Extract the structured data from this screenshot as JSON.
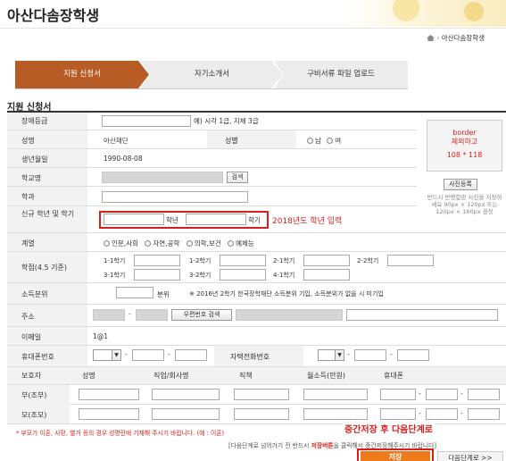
{
  "page": {
    "title": "아산다솜장학생",
    "breadcrumb": "아산다솜장학생"
  },
  "tabs": [
    {
      "label": "지원 신청서",
      "active": true
    },
    {
      "label": "자기소개서",
      "active": false
    },
    {
      "label": "구비서류 파일 업로드",
      "active": false
    }
  ],
  "section_title": "지원 신청서",
  "form": {
    "grade_label": "장애등급",
    "grade_hint": "예) 시각 1급, 지체 3급",
    "name_label": "성명",
    "name_value": "아산재단",
    "gender_label": "성별",
    "gender_options": [
      "남",
      "여"
    ],
    "birth_label": "생년월일",
    "birth_value": "1990-08-08",
    "school_label": "학교명",
    "search_label": "검색",
    "major_label": "학과",
    "year_label": "신규 학년 및 학기",
    "year_unit": "학년",
    "term_unit": "학기",
    "year_note": "2018년도 학년 입력",
    "field_label": "계열",
    "field_options": [
      "인문,사회",
      "자연,공학",
      "의학,보건",
      "예체능"
    ],
    "gpa_label": "학점(4.5 기준)",
    "gpa_terms": [
      "1-1학기",
      "1-2학기",
      "2-1학기",
      "2-2학기",
      "3-1학기",
      "3-2학기",
      "4-1학기"
    ],
    "income_label": "소득분위",
    "income_unit": "분위",
    "income_note": "※ 2016년 2학기 한국장학재단 소득분위 기입, 소득분위가 없을 시 미기입",
    "address_label": "주소",
    "zip_button": "우편번호 검색",
    "email_label": "이메일",
    "email_value": "1@1",
    "mobile_label": "휴대폰번호",
    "home_phone_label": "자택전화번호"
  },
  "photo": {
    "line1": "border",
    "line2": "제외하고",
    "size": "108 * 118",
    "button": "사진등록",
    "note": "반드시 반명함판 사진을 저장하세요 90px × 120px 또는 120px × 160px 권장"
  },
  "guardian": {
    "headers": [
      "보호자",
      "성명",
      "직업/회사명",
      "직책",
      "월소득(만원)",
      "휴대폰"
    ],
    "rows": [
      "부(조부)",
      "모(조모)"
    ]
  },
  "footer": {
    "notice": "* 부모가 이혼, 사망, 별거 등의 경우 성명란에 기재해 주시기 바랍니다. (예 : 이혼)",
    "overlay_note": "중간저장 후 다음단계로",
    "small_note_a": "[다음단계로 넘어가기 전 반드시 ",
    "small_note_b": "저장버튼",
    "small_note_c": "을 클릭해서 중간저장해주시기 바랍니다]",
    "save_button": "저장",
    "next_button": "다음단계로 >>"
  },
  "colors": {
    "accent_red": "#d81e1e",
    "tab_active": "#b85c25",
    "tab_inactive": "#ececec",
    "header_bg": "#f2f2f2",
    "save_orange": "#ee7a1a"
  }
}
